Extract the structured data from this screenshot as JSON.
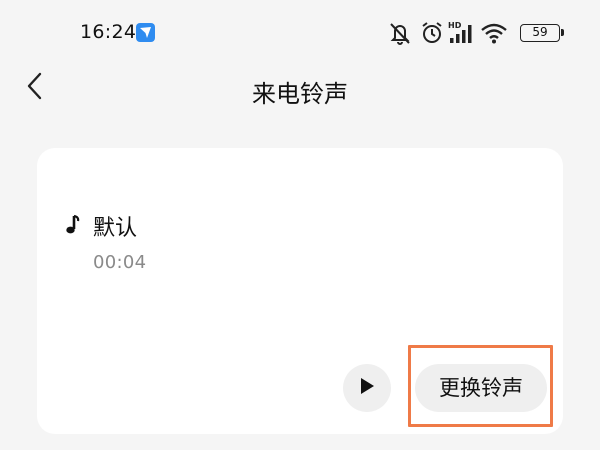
{
  "status_bar": {
    "time": "16:24",
    "battery_level": "59",
    "icons": [
      "app-badge-icon",
      "mute-icon",
      "alarm-icon",
      "signal-hd-icon",
      "wifi-icon",
      "battery-icon"
    ]
  },
  "header": {
    "title": "来电铃声",
    "back_icon": "chevron-left-icon"
  },
  "ringtone": {
    "name": "默认",
    "duration": "00:04",
    "icon": "music-note-icon"
  },
  "actions": {
    "play_icon": "play-icon",
    "change_label": "更换铃声"
  },
  "highlight_color": "#ef7a47"
}
